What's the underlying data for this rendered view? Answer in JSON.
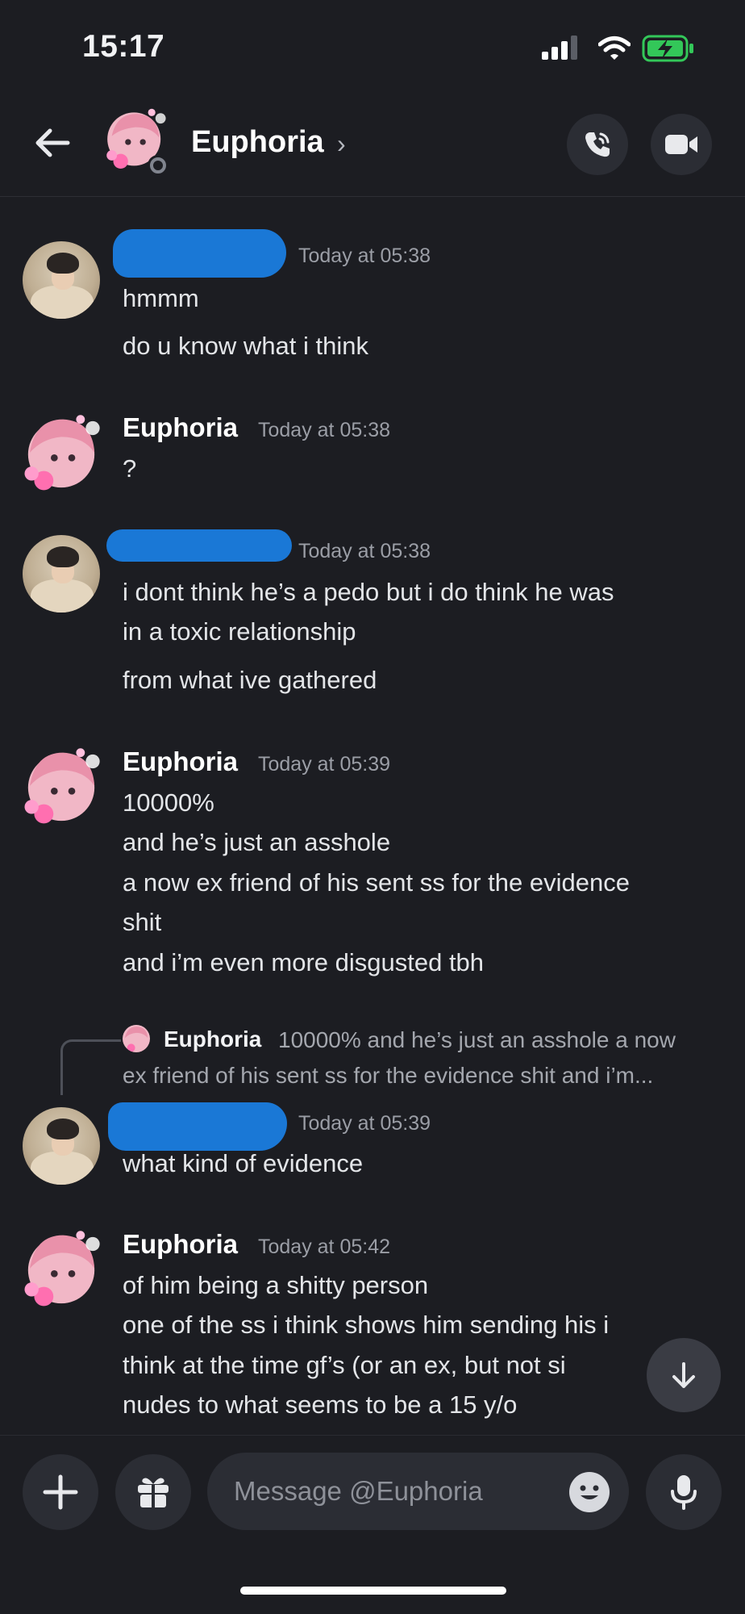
{
  "status_bar": {
    "time": "15:17"
  },
  "header": {
    "channel_name": "Euphoria",
    "chevron": "›"
  },
  "messages": [
    {
      "author": "",
      "timestamp": "Today at 05:38",
      "lines": [
        "hmmm",
        "do u know what i think"
      ]
    },
    {
      "author": "Euphoria",
      "timestamp": "Today at 05:38",
      "lines": [
        "?"
      ]
    },
    {
      "author": "",
      "timestamp": "Today at 05:38",
      "lines": [
        "i dont think he’s a pedo but i do think he was",
        "in a toxic relationship",
        "from what ive gathered"
      ]
    },
    {
      "author": "Euphoria",
      "timestamp": "Today at 05:39",
      "lines": [
        "10000%",
        "and he’s just an asshole",
        "a now ex friend of his sent ss for the evidence",
        "shit",
        "and i’m even more disgusted tbh"
      ]
    },
    {
      "author": "",
      "timestamp": "Today at 05:39",
      "lines": [
        "what kind of evidence"
      ]
    },
    {
      "author": "Euphoria",
      "timestamp": "Today at 05:42",
      "lines": [
        "of him being a shitty person",
        "one of the ss i think shows him sending his i",
        "think at the time gf’s (or an ex, but not si",
        "nudes to what seems to be a 15 y/o"
      ]
    }
  ],
  "reply": {
    "author": "Euphoria",
    "preview_line1": "10000% and he’s just an asshole a now",
    "preview_line2": "ex friend of his sent ss for the evidence shit and i’m..."
  },
  "composer": {
    "placeholder": "Message @Euphoria"
  },
  "icons": [
    "back-arrow-icon",
    "call-icon",
    "video-icon",
    "plus-icon",
    "gift-icon",
    "emoji-icon",
    "microphone-icon",
    "arrow-down-icon",
    "signal-icon",
    "wifi-icon",
    "battery-charging-icon"
  ],
  "colors": {
    "background": "#1c1d22",
    "redaction": "#1a78d6",
    "battery": "#33c759"
  }
}
